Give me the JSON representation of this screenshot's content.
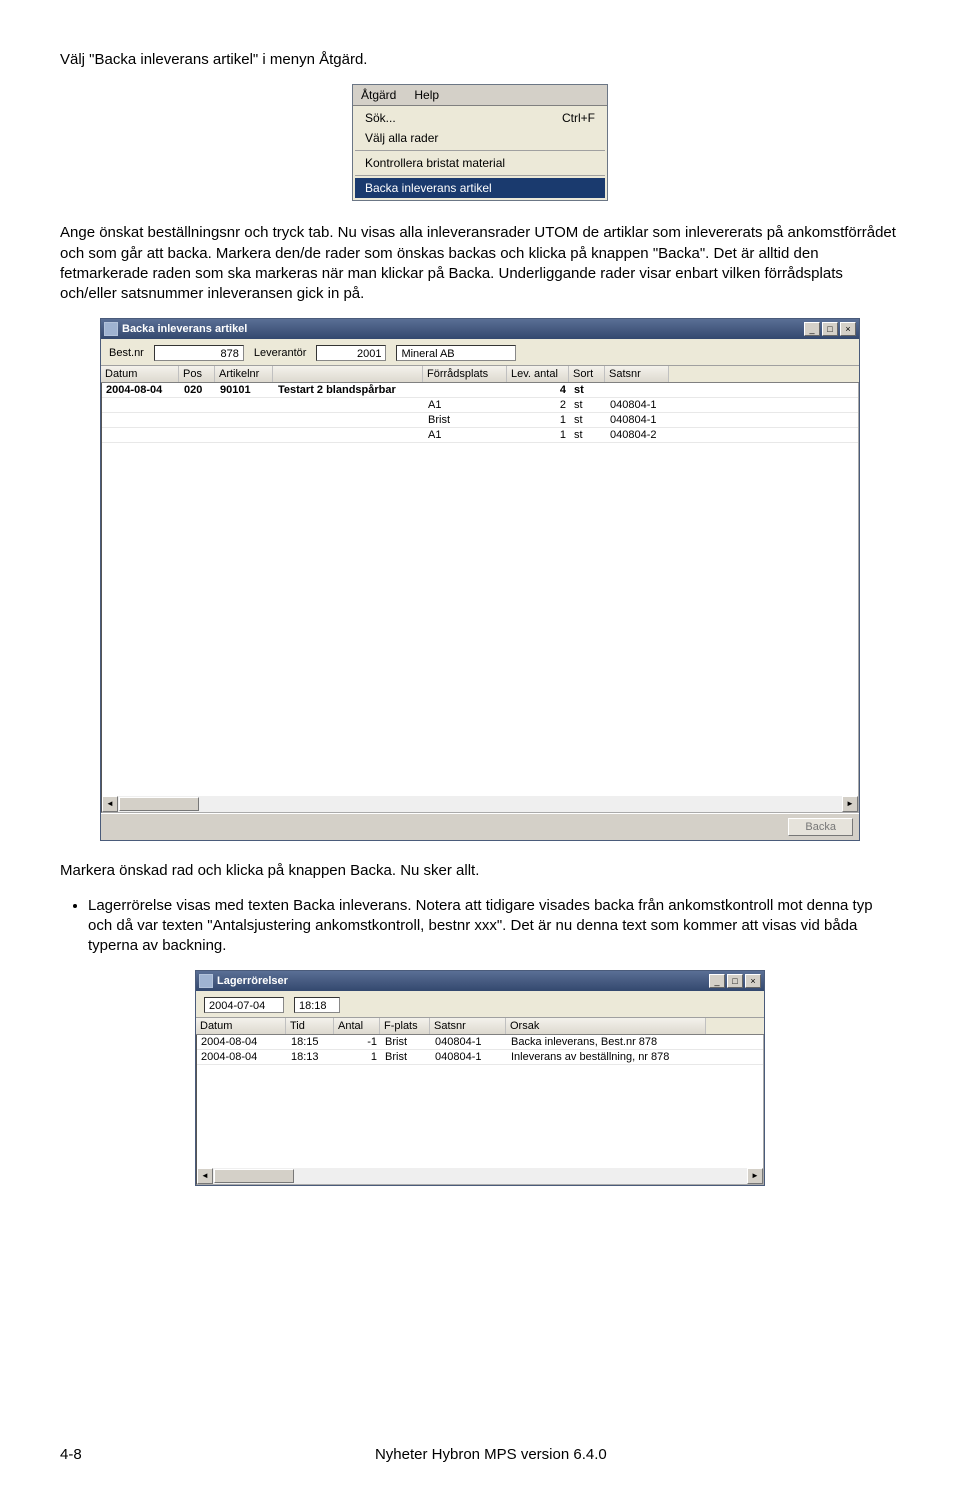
{
  "para1": "Välj \"Backa inleverans artikel\" i menyn Åtgärd.",
  "menu": {
    "bar": [
      "Åtgärd",
      "Help"
    ],
    "items": [
      {
        "label": "Sök...",
        "shortcut": "Ctrl+F"
      },
      {
        "label": "Välj alla rader",
        "shortcut": ""
      }
    ],
    "sep_label": "Kontrollera bristat material",
    "highlighted": "Backa inleverans artikel"
  },
  "para2": "Ange önskat beställningsnr och tryck tab. Nu visas alla inleveransrader UTOM de artiklar som inlevererats på ankomstförrådet och som går att backa. Markera den/de rader som önskas backas och klicka på knappen \"Backa\". Det är alltid den fetmarkerade raden som ska markeras när man klickar på Backa. Underliggande rader visar enbart vilken förrådsplats och/eller satsnummer inleveransen gick in på.",
  "win1": {
    "title": "Backa inleverans artikel",
    "fields": {
      "bestnr_label": "Best.nr",
      "bestnr_value": "878",
      "lev_label": "Leverantör",
      "lev_value": "2001",
      "lev_name": "Mineral AB"
    },
    "headers": [
      "Datum",
      "Pos",
      "Artikelnr",
      "",
      "Förrådsplats",
      "Lev. antal",
      "Sort",
      "Satsnr"
    ],
    "rows": [
      {
        "datum": "2004-08-04",
        "pos": "020",
        "art": "90101",
        "desc": "Testart 2 blandspårbar",
        "fp": "",
        "antal": "4",
        "sort": "st",
        "sats": "",
        "bold": true
      },
      {
        "datum": "",
        "pos": "",
        "art": "",
        "desc": "",
        "fp": "A1",
        "antal": "2",
        "sort": "st",
        "sats": "040804-1",
        "bold": false
      },
      {
        "datum": "",
        "pos": "",
        "art": "",
        "desc": "",
        "fp": "Brist",
        "antal": "1",
        "sort": "st",
        "sats": "040804-1",
        "bold": false
      },
      {
        "datum": "",
        "pos": "",
        "art": "",
        "desc": "",
        "fp": "A1",
        "antal": "1",
        "sort": "st",
        "sats": "040804-2",
        "bold": false
      }
    ],
    "button": "Backa"
  },
  "para3": "Markera önskad rad och klicka på knappen Backa. Nu sker allt.",
  "bullet": "Lagerrörelse visas med texten Backa inleverans. Notera att tidigare visades backa från ankomstkontroll mot denna typ och då var texten \"Antalsjustering ankomstkontroll, bestnr xxx\". Det är nu denna text som kommer att visas vid båda typerna av backning.",
  "win2": {
    "title": "Lagerrörelser",
    "topdate": "2004-07-04",
    "toptime": "18:18",
    "headers": [
      "Datum",
      "Tid",
      "Antal",
      "F-plats",
      "Satsnr",
      "Orsak"
    ],
    "rows": [
      {
        "datum": "2004-08-04",
        "tid": "18:15",
        "antal": "-1",
        "fp": "Brist",
        "sats": "040804-1",
        "orsak": "Backa inleverans, Best.nr 878"
      },
      {
        "datum": "2004-08-04",
        "tid": "18:13",
        "antal": "1",
        "fp": "Brist",
        "sats": "040804-1",
        "orsak": "Inleverans av beställning, nr  878"
      }
    ]
  },
  "footer": {
    "left": "4-8",
    "center": "Nyheter Hybron MPS version 6.4.0"
  }
}
